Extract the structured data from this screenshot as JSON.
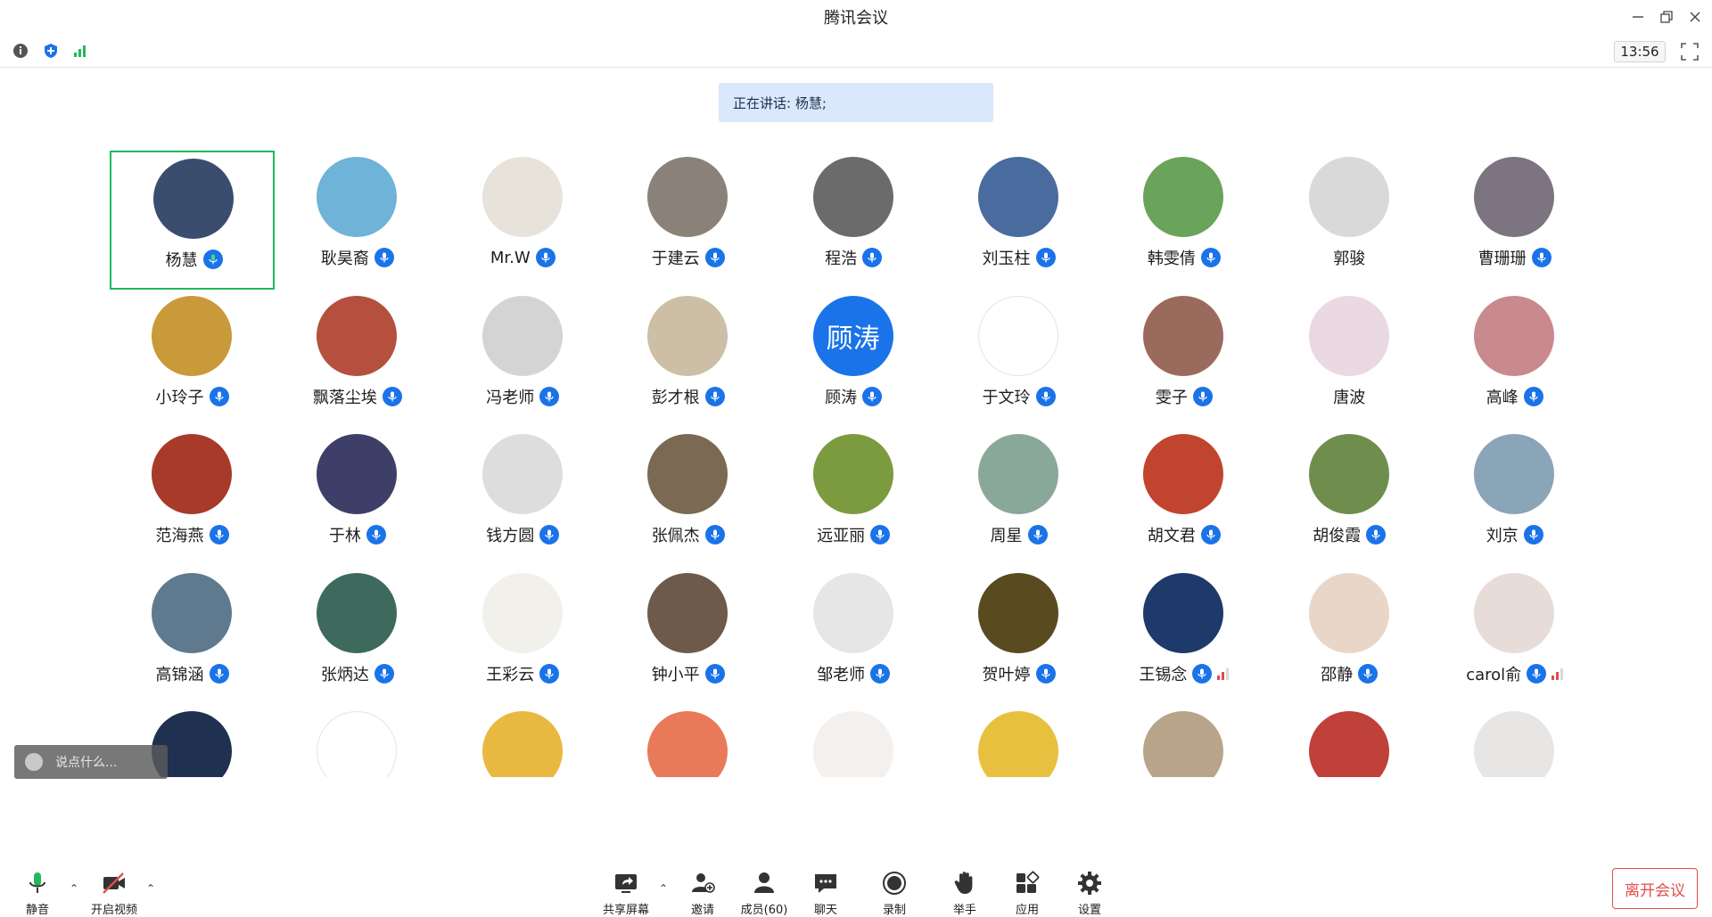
{
  "window": {
    "title": "腾讯会议"
  },
  "infobar": {
    "clock": "13:56"
  },
  "speaking": {
    "text": "正在讲话: 杨慧;"
  },
  "colors": {
    "accent": "#1a73e8",
    "active_border": "#22b85c",
    "leave": "#e34c4c"
  },
  "participants": [
    {
      "name": "杨慧",
      "active": true,
      "mic": "green",
      "avatar": "#3b4d6e"
    },
    {
      "name": "耿昊裔",
      "mic": "blue",
      "avatar": "#6fb3d8"
    },
    {
      "name": "Mr.W",
      "mic": "blue",
      "avatar": "#e8e3da"
    },
    {
      "name": "于建云",
      "mic": "blue",
      "avatar": "#8a8278"
    },
    {
      "name": "程浩",
      "mic": "blue",
      "avatar": "#6b6b6b"
    },
    {
      "name": "刘玉柱",
      "mic": "blue",
      "avatar": "#4a6b9e"
    },
    {
      "name": "韩雯倩",
      "mic": "blue",
      "avatar": "#6aa35a"
    },
    {
      "name": "郭骏",
      "mic": "none",
      "avatar": "#d9d9d9"
    },
    {
      "name": "曹珊珊",
      "mic": "blue",
      "avatar": "#7c7480"
    },
    {
      "name": "小玲子",
      "mic": "blue",
      "avatar": "#c99a3a"
    },
    {
      "name": "飘落尘埃",
      "mic": "blue",
      "avatar": "#b5503e"
    },
    {
      "name": "冯老师",
      "mic": "blue",
      "avatar": "#d4d4d4"
    },
    {
      "name": "彭才根",
      "mic": "blue",
      "avatar": "#cdbfa6"
    },
    {
      "name": "顾涛",
      "mic": "blue",
      "avatar": "#1a73e8",
      "initials": "顾涛"
    },
    {
      "name": "于文玲",
      "mic": "blue",
      "avatar": "#ffffff"
    },
    {
      "name": "雯子",
      "mic": "blue",
      "avatar": "#9a6b5c"
    },
    {
      "name": "唐波",
      "mic": "none",
      "avatar": "#ead8e2"
    },
    {
      "name": "高峰",
      "mic": "blue",
      "avatar": "#c88a8e"
    },
    {
      "name": "范海燕",
      "mic": "blue",
      "avatar": "#a83a2a"
    },
    {
      "name": "于林",
      "mic": "blue",
      "avatar": "#3d3f68"
    },
    {
      "name": "钱方圆",
      "mic": "blue",
      "avatar": "#dddddd"
    },
    {
      "name": "张佩杰",
      "mic": "blue",
      "avatar": "#7a6a54"
    },
    {
      "name": "远亚丽",
      "mic": "blue",
      "avatar": "#7c9a3e"
    },
    {
      "name": "周星",
      "mic": "blue",
      "avatar": "#8aa89a"
    },
    {
      "name": "胡文君",
      "mic": "blue",
      "avatar": "#c1442f"
    },
    {
      "name": "胡俊霞",
      "mic": "blue",
      "avatar": "#6f8e4e"
    },
    {
      "name": "刘京",
      "mic": "blue",
      "avatar": "#8aa4b8"
    },
    {
      "name": "高锦涵",
      "mic": "blue",
      "avatar": "#5f7a8e"
    },
    {
      "name": "张炳达",
      "mic": "blue",
      "avatar": "#3e6a5e"
    },
    {
      "name": "王彩云",
      "mic": "blue",
      "avatar": "#f2f0ea"
    },
    {
      "name": "钟小平",
      "mic": "blue",
      "avatar": "#6e5a4a"
    },
    {
      "name": "邹老师",
      "mic": "blue",
      "avatar": "#e6e6e6"
    },
    {
      "name": "贺叶婷",
      "mic": "blue",
      "avatar": "#5a4a20"
    },
    {
      "name": "王锡念",
      "mic": "blue",
      "signal": true,
      "avatar": "#1d3a6a"
    },
    {
      "name": "邵静",
      "mic": "blue",
      "avatar": "#e8d6c8"
    },
    {
      "name": "carol俞",
      "mic": "blue",
      "signal": true,
      "avatar": "#e7dcd8"
    },
    {
      "name": "",
      "mic": "none",
      "avatar": "#1f3050"
    },
    {
      "name": "",
      "mic": "none",
      "avatar": "#ffffff"
    },
    {
      "name": "",
      "mic": "none",
      "avatar": "#e9b840"
    },
    {
      "name": "",
      "mic": "none",
      "avatar": "#e87a5a"
    },
    {
      "name": "",
      "mic": "none",
      "avatar": "#f4f0ee"
    },
    {
      "name": "",
      "mic": "none",
      "avatar": "#e8c040"
    },
    {
      "name": "",
      "mic": "none",
      "avatar": "#b8a48a"
    },
    {
      "name": "",
      "mic": "none",
      "avatar": "#c0403a"
    },
    {
      "name": "",
      "mic": "none",
      "avatar": "#e8e6e4"
    }
  ],
  "chat": {
    "placeholder": "说点什么..."
  },
  "toolbar": {
    "mute": "静音",
    "video": "开启视频",
    "share": "共享屏幕",
    "invite": "邀请",
    "members": "成员(60)",
    "chat": "聊天",
    "record": "录制",
    "raise_hand": "举手",
    "apps": "应用",
    "settings": "设置",
    "leave": "离开会议"
  }
}
